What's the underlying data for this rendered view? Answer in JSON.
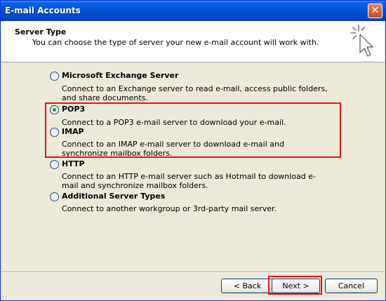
{
  "window": {
    "title": "E-mail Accounts",
    "close_glyph": "✕"
  },
  "header": {
    "title": "Server Type",
    "subtitle": "You can choose the type of server your new e-mail account will work with.",
    "icon": "cursor-sparkle-icon"
  },
  "options": [
    {
      "label": "Microsoft Exchange Server",
      "description": "Connect to an Exchange server to read e-mail, access public folders, and share documents.",
      "checked": false
    },
    {
      "label": "POP3",
      "description": "Connect to a POP3 e-mail server to download your e-mail.",
      "checked": true
    },
    {
      "label": "IMAP",
      "description": "Connect to an IMAP e-mail server to download e-mail and synchronize mailbox folders.",
      "checked": false
    },
    {
      "label": "HTTP",
      "description": "Connect to an HTTP e-mail server such as Hotmail to download e-mail and synchronize mailbox folders.",
      "checked": false
    },
    {
      "label": "Additional Server Types",
      "description": "Connect to another workgroup or 3rd-party mail server.",
      "checked": false
    }
  ],
  "buttons": {
    "back": "< Back",
    "next": "Next >",
    "cancel": "Cancel"
  },
  "colors": {
    "titlebar": "#0453d9",
    "highlight": "#e0141a",
    "radio_checked": "#21a121"
  }
}
